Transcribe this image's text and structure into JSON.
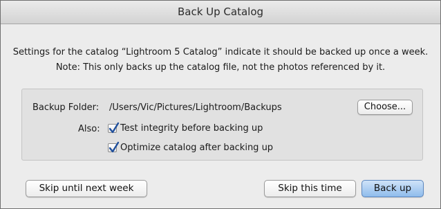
{
  "window": {
    "title": "Back Up Catalog"
  },
  "message": {
    "line1": "Settings for the catalog “Lightroom 5 Catalog” indicate it should be backed up once a week.",
    "line2": "Note: This only backs up the catalog file, not the photos referenced by it."
  },
  "backup_settings": {
    "folder_label": "Backup Folder:",
    "folder_path": "/Users/Vic/Pictures/Lightroom/Backups",
    "choose_label": "Choose...",
    "also_label": "Also:",
    "options": [
      {
        "label": "Test integrity before backing up",
        "checked": true
      },
      {
        "label": "Optimize catalog after backing up",
        "checked": true
      }
    ]
  },
  "buttons": {
    "skip_until_next_week": "Skip until next week",
    "skip_this_time": "Skip this time",
    "back_up": "Back up"
  },
  "colors": {
    "default_button": "#8fbcec",
    "checkmark": "#1f4f9c"
  }
}
